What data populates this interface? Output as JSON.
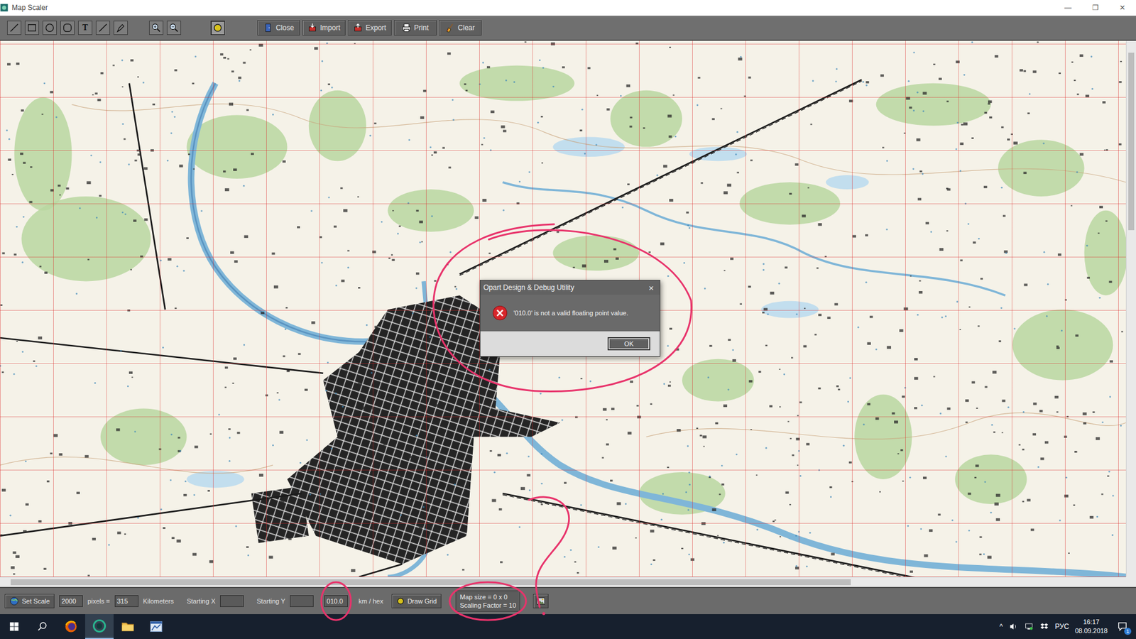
{
  "window": {
    "title": "Map Scaler",
    "controls": [
      "—",
      "❐",
      "✕"
    ]
  },
  "toolbar": {
    "tools": [
      {
        "kind": "line",
        "selected": false
      },
      {
        "kind": "rect",
        "selected": false
      },
      {
        "kind": "ellipse",
        "selected": false
      },
      {
        "kind": "rounded",
        "selected": false
      },
      {
        "kind": "text",
        "label": "T",
        "selected": false
      },
      {
        "kind": "line",
        "selected": false
      },
      {
        "kind": "pen",
        "selected": false
      },
      {
        "kind": "zoom-in",
        "selected": false
      },
      {
        "kind": "zoom-out",
        "selected": false
      },
      {
        "kind": "hex",
        "selected": true
      }
    ],
    "buttons": [
      {
        "label": "Close",
        "kind": "close"
      },
      {
        "label": "Import",
        "kind": "import"
      },
      {
        "label": "Export",
        "kind": "export"
      },
      {
        "label": "Print",
        "kind": "print"
      },
      {
        "label": "Clear",
        "kind": "clear"
      }
    ]
  },
  "dialog": {
    "title": "Opart Design & Debug Utility",
    "close": "×",
    "message": "'010.0' is not a valid floating point value.",
    "button": "OK"
  },
  "bottom_bar": {
    "set_scale": "Set Scale",
    "pixels": "2000",
    "pixels_label": "pixels =",
    "distance": "315",
    "distance_label": "Kilometers",
    "start_x_label": "Starting X",
    "start_x": "",
    "start_y_label": "Starting Y",
    "start_y": "",
    "hex_size": "010.0",
    "hex_label": "km / hex",
    "draw_grid": "Draw Grid",
    "status": [
      "Map size = 0 x 0",
      "Scaling Factor = 10"
    ]
  },
  "taskbar": {
    "apps": [
      {
        "kind": "firefox",
        "selected": false
      },
      {
        "kind": "opart",
        "selected": true
      },
      {
        "kind": "explorer",
        "selected": false
      },
      {
        "kind": "mapscaler",
        "selected": false
      }
    ],
    "tray": {
      "chevron": "^",
      "language": "РУС",
      "time": "16:17",
      "date": "08.09.2018",
      "notifications": "1"
    }
  }
}
